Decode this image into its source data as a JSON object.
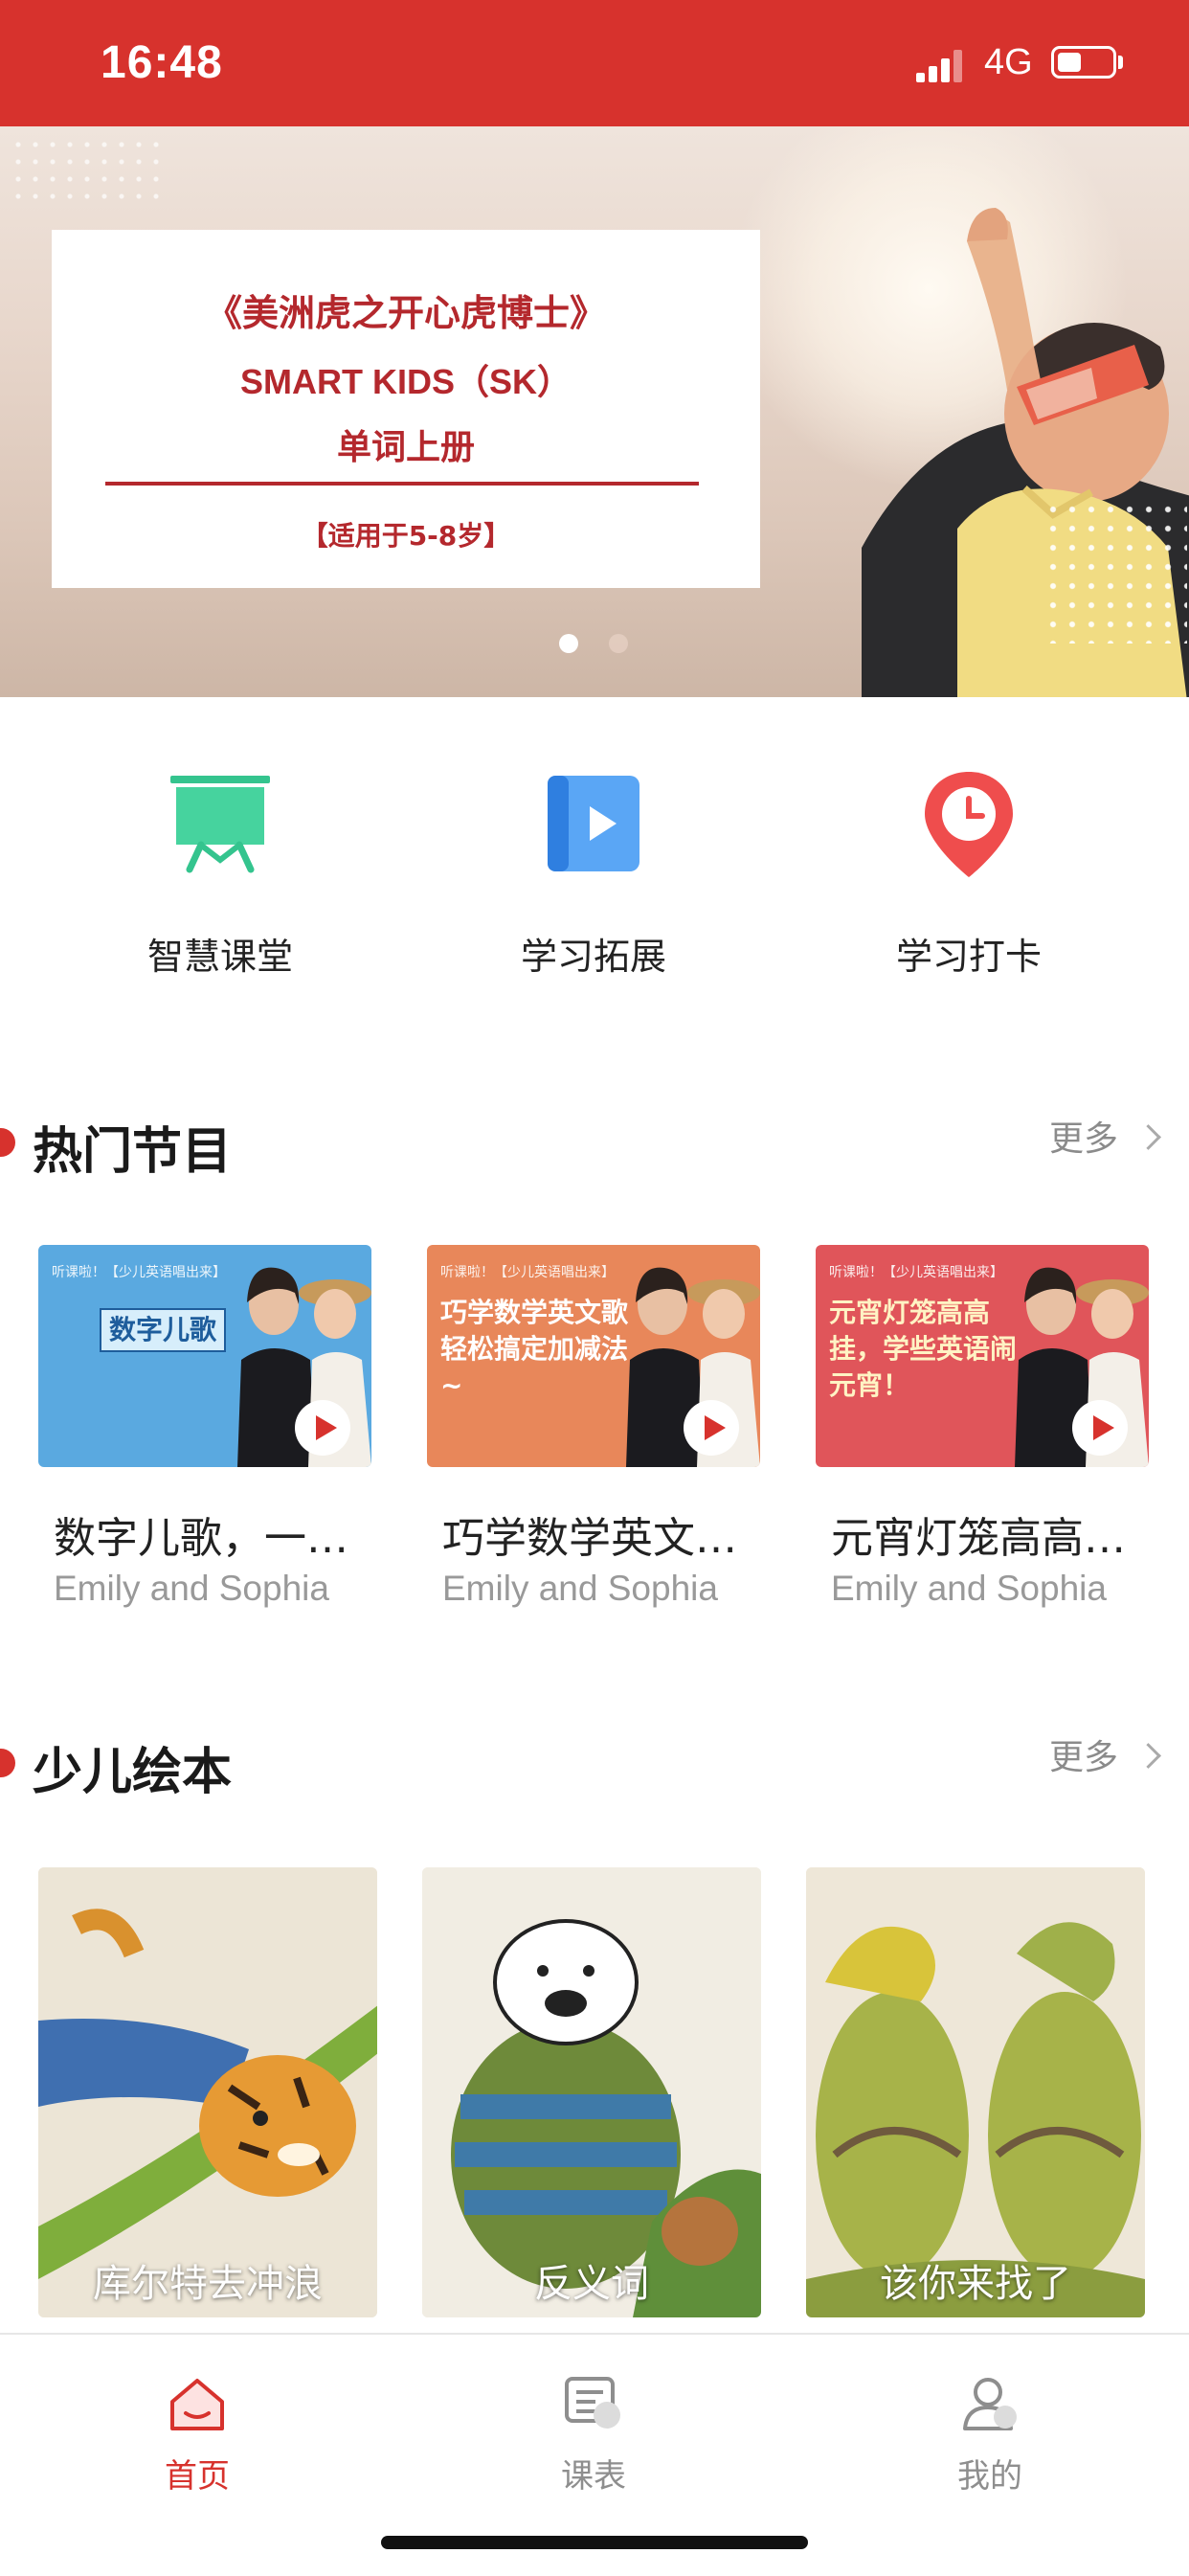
{
  "status_bar": {
    "time": "16:48",
    "network": "4G"
  },
  "banner": {
    "line1": "《美洲虎之开心虎博士》",
    "line2": "SMART KIDS（SK）",
    "line3": "单词上册",
    "line4": "【适用于5-8岁】",
    "page_count": 2,
    "active_page": 1
  },
  "menu": [
    {
      "label": "智慧课堂",
      "icon": "blackboard-icon",
      "color": "#3fcf9a"
    },
    {
      "label": "学习拓展",
      "icon": "video-play-icon",
      "color": "#3b8ff0"
    },
    {
      "label": "学习打卡",
      "icon": "clock-pin-icon",
      "color": "#ef4d4d"
    }
  ],
  "hot": {
    "title": "热门节目",
    "more": "更多",
    "items": [
      {
        "title": "数字儿歌，一…",
        "author": "Emily and Sophia",
        "thumb_text": "数字儿歌",
        "bg": "#5aa9e0"
      },
      {
        "title": "巧学数学英文…",
        "author": "Emily and Sophia",
        "thumb_text": "巧学数学英文歌 轻松搞定加减法~",
        "bg": "#e8875a"
      },
      {
        "title": "元宵灯笼高高…",
        "author": "Emily and Sophia",
        "thumb_text": "元宵灯笼高高挂，学些英语闹元宵！",
        "bg": "#e0555a"
      }
    ]
  },
  "books": {
    "title": "少儿绘本",
    "more": "更多",
    "items": [
      {
        "label": "库尔特去冲浪",
        "icon": "tiger-surfing-illustration"
      },
      {
        "label": "反义词",
        "icon": "bears-illustration"
      },
      {
        "label": "该你来找了",
        "icon": "turtles-illustration"
      }
    ]
  },
  "tabbar": {
    "items": [
      {
        "label": "首页",
        "icon": "home-icon",
        "active": true
      },
      {
        "label": "课表",
        "icon": "schedule-icon",
        "active": false
      },
      {
        "label": "我的",
        "icon": "profile-icon",
        "active": false
      }
    ]
  },
  "colors": {
    "brand_red": "#d7322d",
    "muted": "#999999"
  }
}
